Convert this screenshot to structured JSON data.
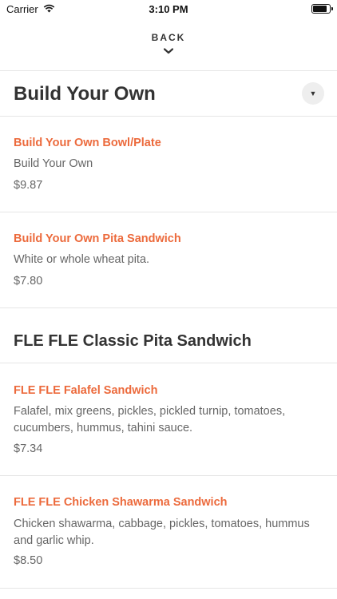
{
  "status_bar": {
    "carrier": "Carrier",
    "time": "3:10 PM",
    "icons": [
      "wifi-icon",
      "battery-icon"
    ]
  },
  "nav": {
    "back_label": "BACK",
    "back_icon": "chevron-down-icon"
  },
  "sections": [
    {
      "title": "Build Your Own",
      "toggle_icon": "triangle-down-icon",
      "items": [
        {
          "name": "Build Your Own Bowl/Plate",
          "description": "Build Your Own",
          "price": "$9.87"
        },
        {
          "name": "Build Your Own Pita Sandwich",
          "description": "White or whole wheat pita.",
          "price": "$7.80"
        }
      ]
    },
    {
      "title": "FLE FLE Classic Pita Sandwich",
      "items": [
        {
          "name": "FLE FLE Falafel Sandwich",
          "description": "Falafel, mix greens, pickles, pickled turnip, tomatoes, cucumbers, hummus, tahini sauce.",
          "price": "$7.34"
        },
        {
          "name": "FLE FLE Chicken Shawarma Sandwich",
          "description": "Chicken shawarma, cabbage, pickles, tomatoes, hummus and garlic whip.",
          "price": "$8.50"
        }
      ]
    }
  ],
  "colors": {
    "accent": "#ec6a3c",
    "heading": "#333333",
    "body_text": "#666666",
    "divider": "#e6e6e6"
  }
}
